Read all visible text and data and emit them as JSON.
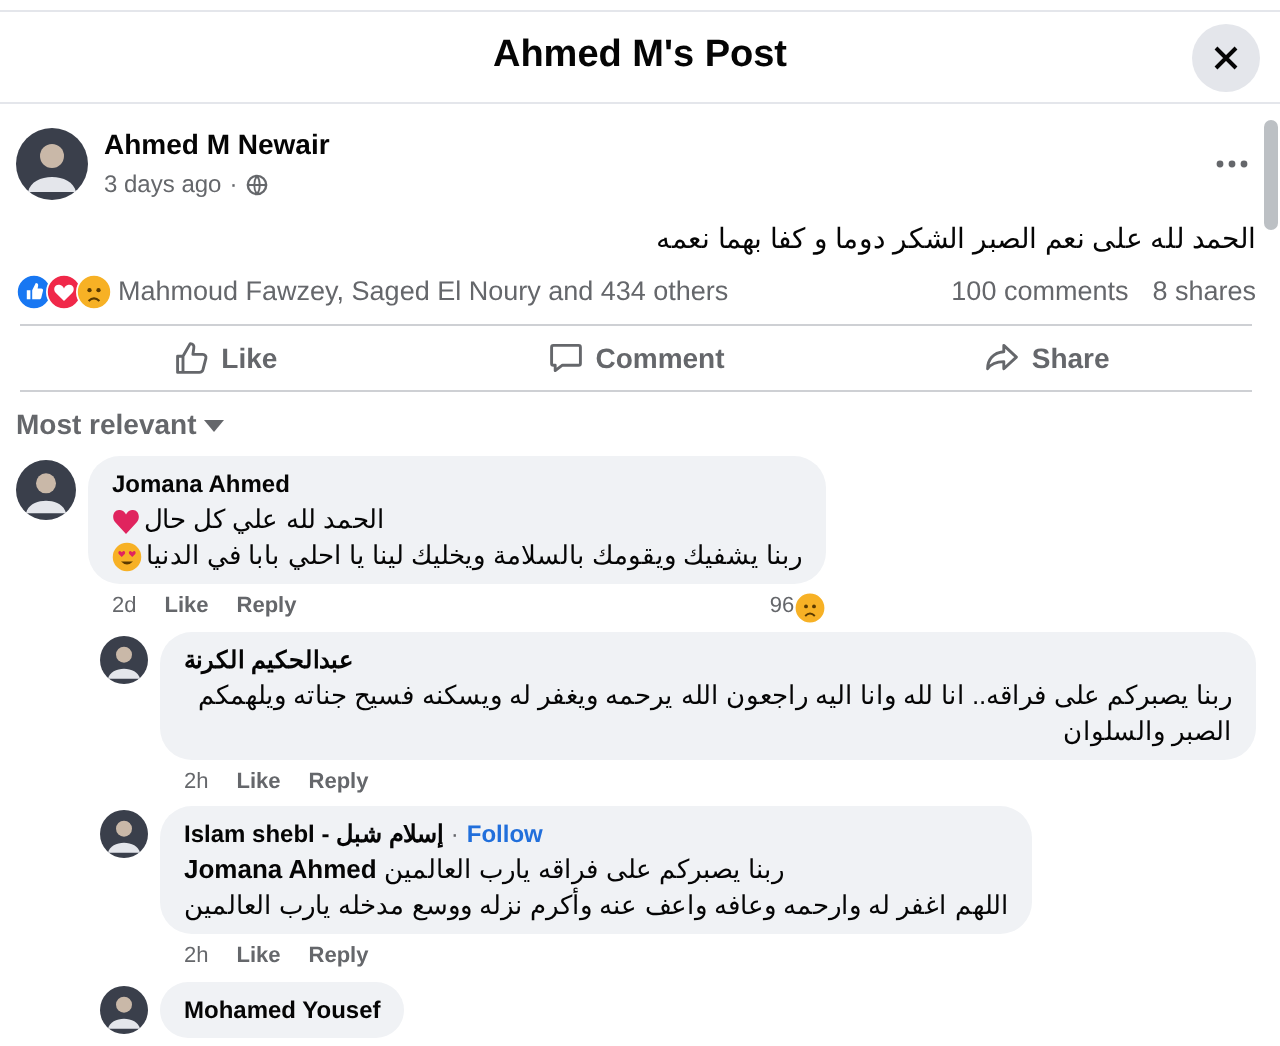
{
  "dialog": {
    "title": "Ahmed M's Post"
  },
  "post": {
    "author": "Ahmed M Newair",
    "time": "3 days ago",
    "separator": "·",
    "text": "الحمد لله على نعم الصبر الشكر دوما و كفا بهما نعمه",
    "reactions": {
      "types": [
        {
          "kind": "like"
        },
        {
          "kind": "love"
        },
        {
          "kind": "sad"
        }
      ],
      "summary": "Mahmoud Fawzey, Saged El Noury and 434 others"
    },
    "comments_count": "100 comments",
    "shares_count": "8 shares",
    "action_bar": {
      "like": {
        "kind": "like",
        "label": "Like"
      },
      "comment": {
        "kind": "comment",
        "label": "Comment"
      },
      "share": {
        "kind": "share",
        "label": "Share"
      }
    }
  },
  "filter": {
    "label": "Most relevant"
  },
  "comments": [
    {
      "author": "Jomana Ahmed",
      "lines": [
        {
          "text": "الحمد لله علي كل حال",
          "emoji": {
            "kind": "heart"
          }
        },
        {
          "text": "ربنا يشفيك ويقومك بالسلامة ويخليك لينا يا احلي بابا في الدنيا",
          "emoji": {
            "kind": "heart-eyes"
          }
        }
      ],
      "time": "2d",
      "like": "Like",
      "reply": "Reply",
      "reaction_count": "96",
      "reaction": {
        "kind": "sad"
      },
      "children": [
        {
          "author": "عبدالحكيم الكرنة",
          "lines": [
            {
              "text": "ربنا يصبركم على فراقه.. انا لله وانا اليه راجعون الله يرحمه ويغفر له ويسكنه فسيح جناته ويلهمكم الصبر والسلوان"
            }
          ],
          "time": "2h",
          "like": "Like",
          "reply": "Reply"
        },
        {
          "author": "Islam shebl - إسلام شبل",
          "separator": "·",
          "follow": "Follow",
          "lines": [
            {
              "text": "**Jomana Ahmed** ربنا يصبركم على فراقه يارب العالمين"
            },
            {
              "text": "اللهم اغفر له وارحمه وعافه واعف عنه وأكرم نزله ووسع مدخله يارب العالمين"
            }
          ],
          "time": "2h",
          "like": "Like",
          "reply": "Reply"
        },
        {
          "author": "Mohamed Yousef"
        }
      ]
    }
  ]
}
